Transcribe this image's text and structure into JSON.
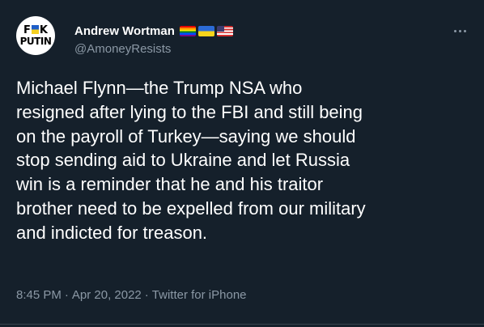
{
  "tweet": {
    "author": {
      "display_name": "Andrew Wortman",
      "handle": "@AmoneyResists",
      "avatar": {
        "line1_left": "F",
        "line1_right": "K",
        "line2": "PUTIN"
      },
      "flags": [
        "rainbow-flag-icon",
        "ukraine-flag-icon",
        "usa-flag-icon"
      ]
    },
    "text_lines": [
      "Michael Flynn—the Trump NSA who",
      "resigned after lying to the FBI and still being",
      "on the payroll of Turkey—saying we should",
      "stop sending aid to Ukraine and let Russia",
      "win is a reminder that he and his traitor",
      "brother need to be expelled from our military",
      "and indicted for treason."
    ],
    "time": "8:45 PM",
    "date": "Apr 20, 2022",
    "source": "Twitter for iPhone",
    "separator": "·"
  },
  "colors": {
    "background": "#15202b",
    "text_primary": "#ffffff",
    "text_secondary": "#8b98a5"
  }
}
